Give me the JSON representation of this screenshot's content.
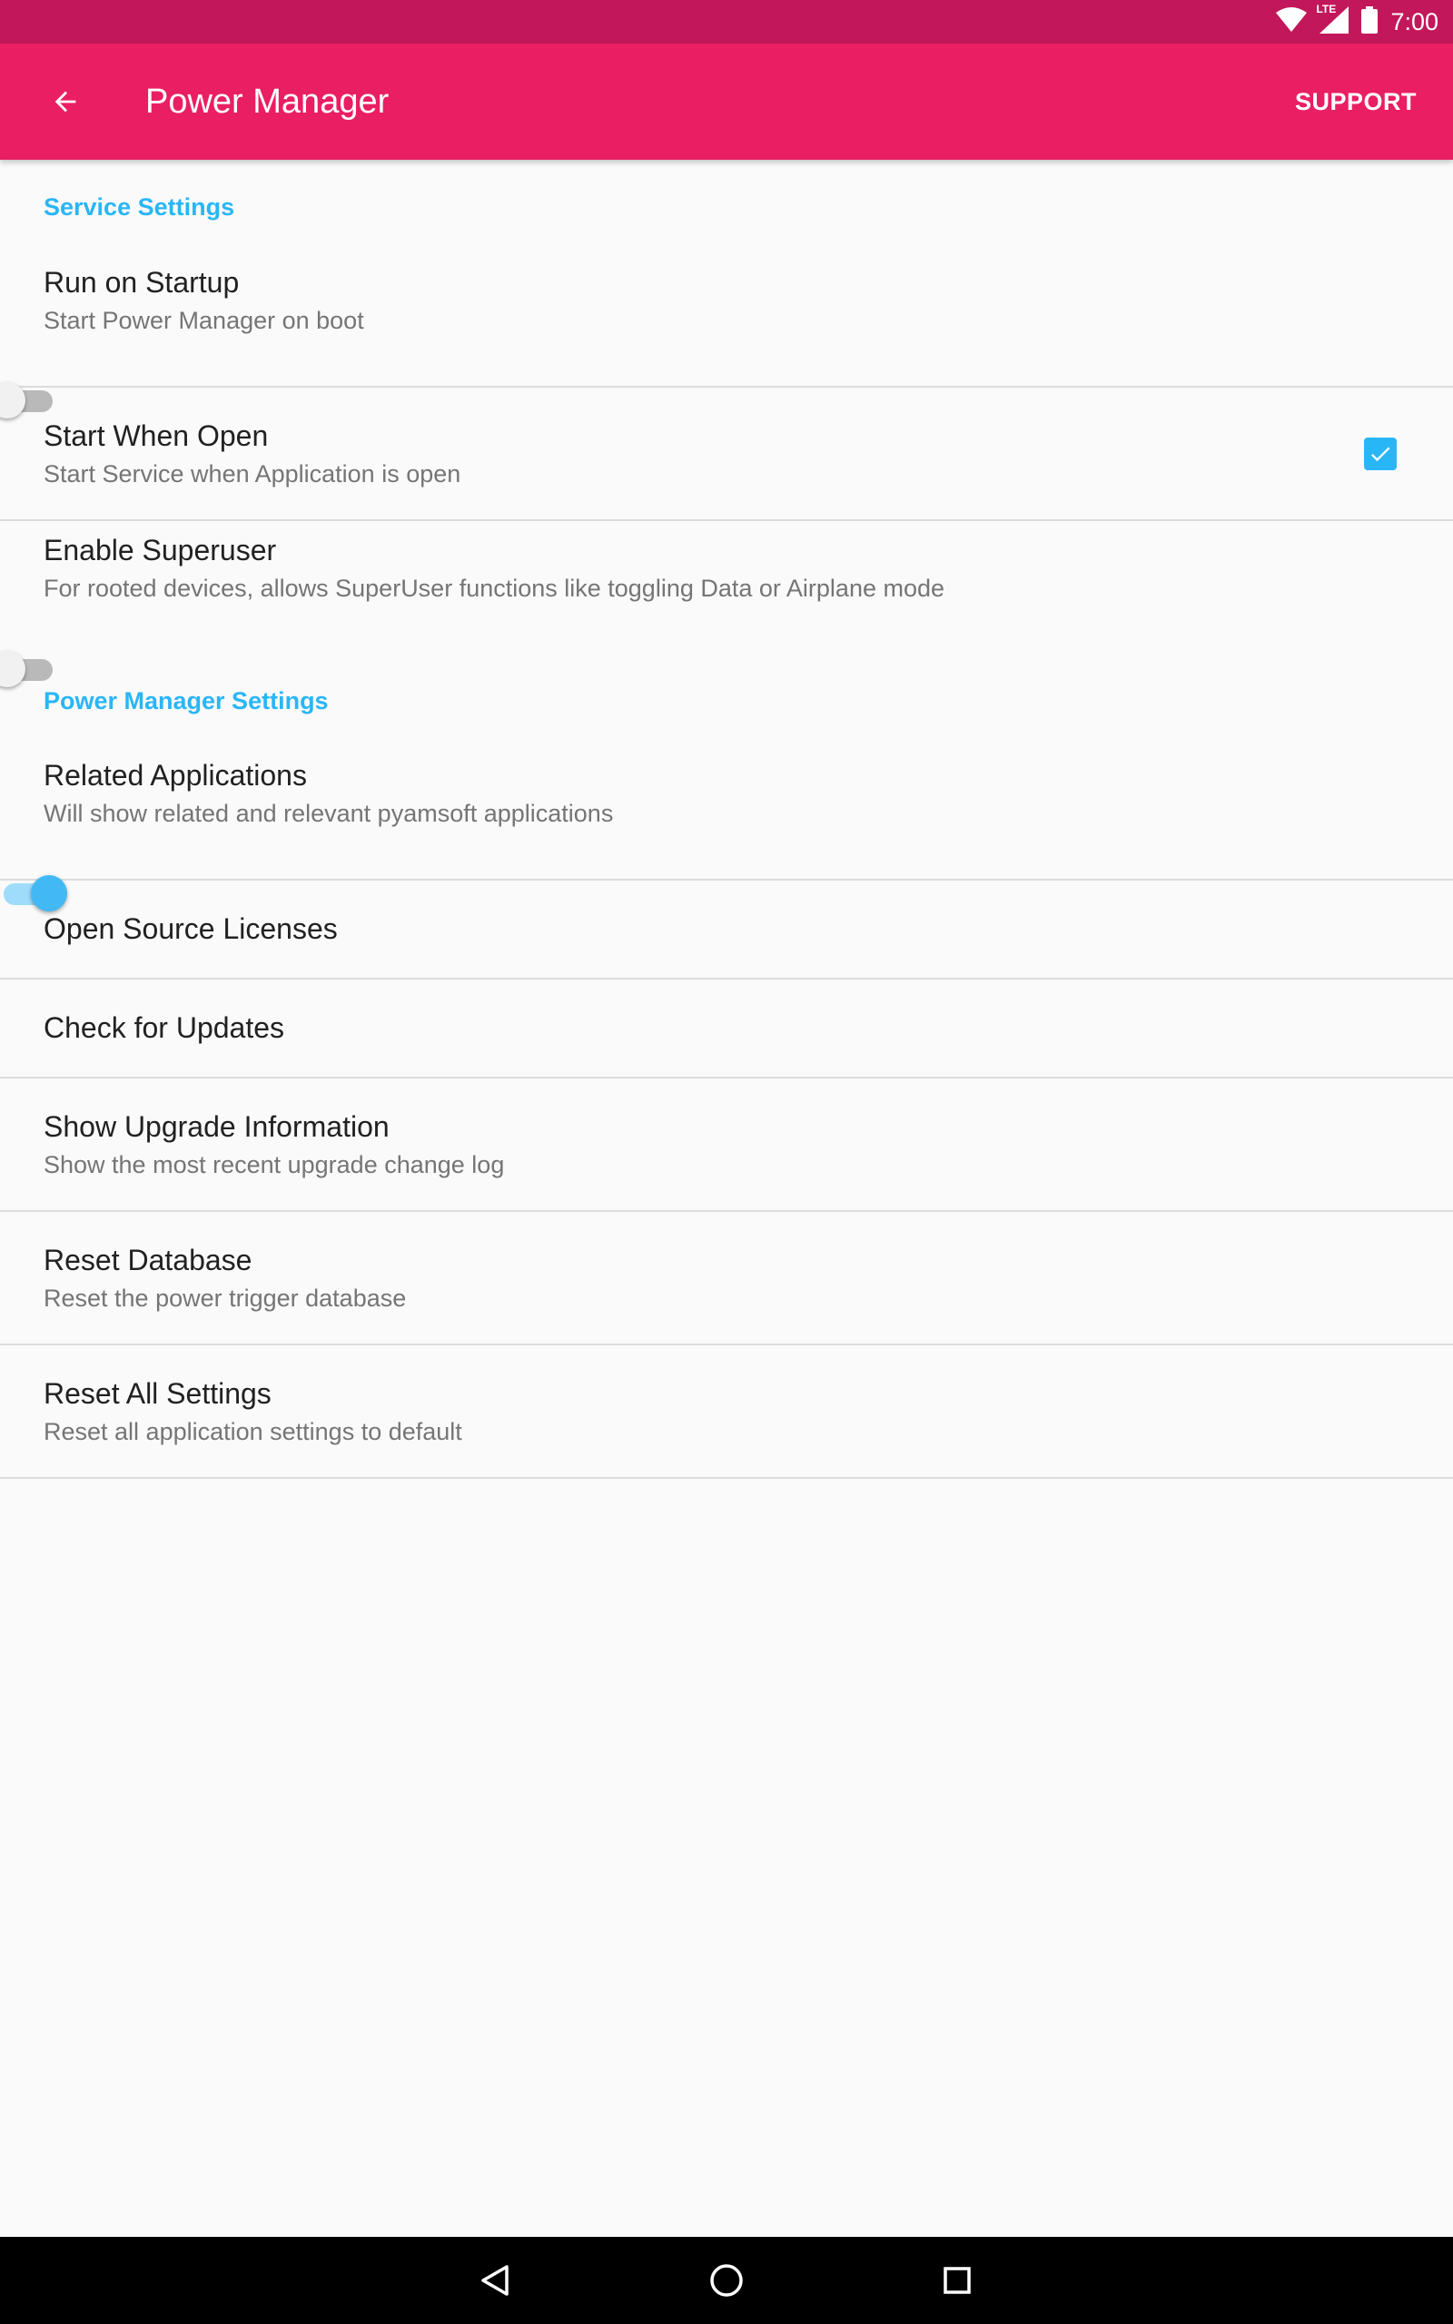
{
  "status_bar": {
    "time": "7:00",
    "lte_label": "LTE",
    "icons": [
      "wifi-icon",
      "signal-lte-icon",
      "battery-icon"
    ]
  },
  "app_bar": {
    "back_icon": "arrow-back-icon",
    "title": "Power Manager",
    "action_label": "SUPPORT",
    "color": "#e91e63"
  },
  "accent_color": "#29b6f6",
  "sections": [
    {
      "header": "Service Settings",
      "items": [
        {
          "title": "Run on Startup",
          "subtitle": "Start Power Manager on boot",
          "control": "switch",
          "checked": false
        },
        {
          "title": "Start When Open",
          "subtitle": "Start Service when Application is open",
          "control": "checkbox",
          "checked": true
        },
        {
          "title": "Enable Superuser",
          "subtitle": "For rooted devices, allows SuperUser functions like toggling Data or Airplane mode",
          "control": "switch",
          "checked": false
        }
      ]
    },
    {
      "header": "Power Manager Settings",
      "items": [
        {
          "title": "Related Applications",
          "subtitle": "Will show related and relevant pyamsoft applications",
          "control": "switch",
          "checked": true
        },
        {
          "title": "Open Source Licenses"
        },
        {
          "title": "Check for Updates"
        },
        {
          "title": "Show Upgrade Information",
          "subtitle": "Show the most recent upgrade change log"
        },
        {
          "title": "Reset Database",
          "subtitle": "Reset the power trigger database"
        },
        {
          "title": "Reset All Settings",
          "subtitle": "Reset all application settings to default"
        }
      ]
    }
  ],
  "nav_bar": {
    "icons": [
      "back-triangle-icon",
      "home-circle-icon",
      "recents-square-icon"
    ]
  }
}
